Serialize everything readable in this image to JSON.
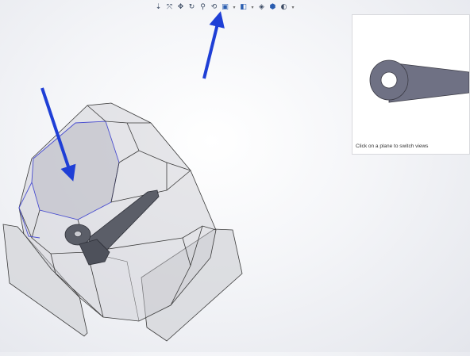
{
  "toolbar": {
    "buttons": [
      {
        "name": "view-orientation-icon",
        "glyph": "⇣"
      },
      {
        "name": "zoom-to-fit-icon",
        "glyph": "⤧"
      },
      {
        "name": "pan-icon",
        "glyph": "✥"
      },
      {
        "name": "rotate-view-icon",
        "glyph": "↻"
      },
      {
        "name": "zoom-to-area-icon",
        "glyph": "⚲"
      },
      {
        "name": "previous-view-icon",
        "glyph": "⟲"
      },
      {
        "name": "section-view-icon",
        "glyph": "▣"
      },
      {
        "name": "dropdown-arrow-icon",
        "glyph": "▾"
      },
      {
        "name": "display-style-icon",
        "glyph": "◧"
      },
      {
        "name": "dropdown-arrow-icon",
        "glyph": "▾"
      },
      {
        "name": "hide-show-items-icon",
        "glyph": "◈"
      },
      {
        "name": "edit-appearance-icon",
        "glyph": "⬢"
      },
      {
        "name": "apply-scene-icon",
        "glyph": "◐"
      },
      {
        "name": "dropdown-arrow-icon",
        "glyph": "▾"
      }
    ]
  },
  "preview": {
    "caption": "Click on a plane to switch views"
  },
  "colors": {
    "annotation_arrow": "#1f3fd6",
    "model_edge": "#3a3a3a",
    "model_face": "#c8c9cf",
    "highlight_edge": "#4a4ed0",
    "part_fill": "#5b5e68"
  }
}
